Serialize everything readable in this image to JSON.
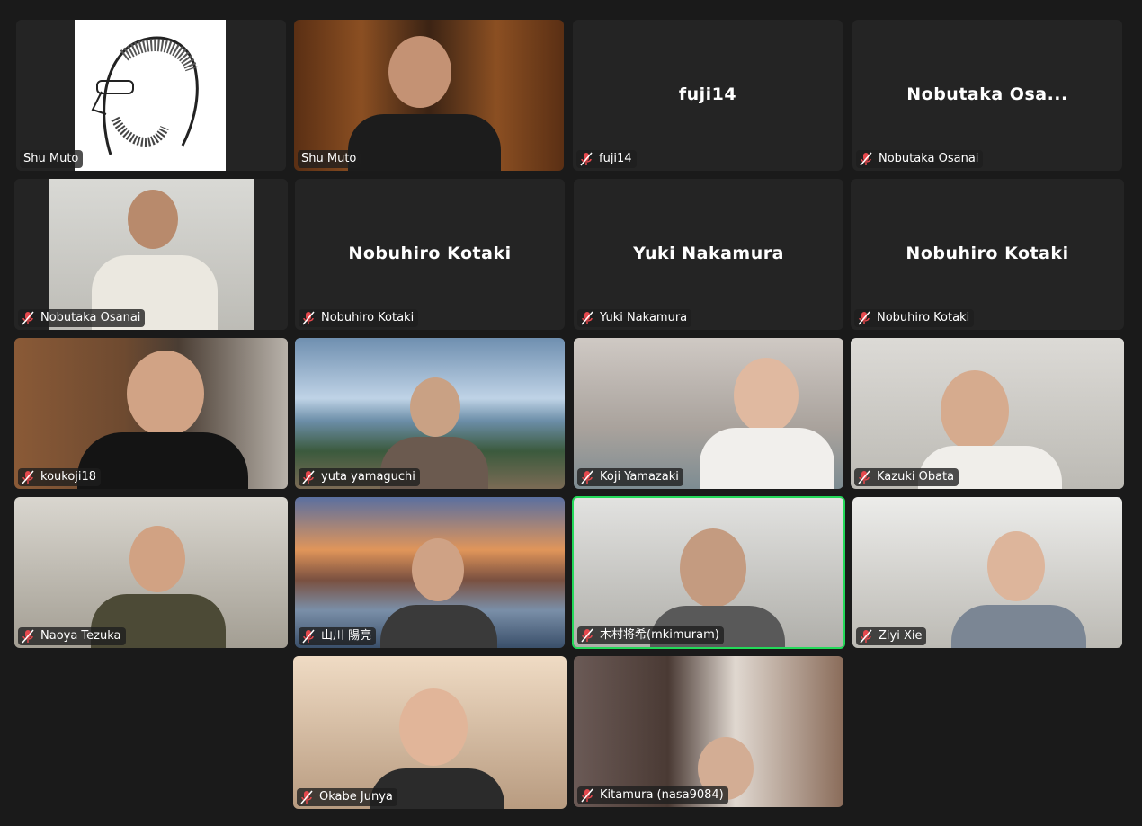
{
  "colors": {
    "background": "#1a1a1a",
    "tile": "#242424",
    "muted_icon": "#e5484d",
    "active_speaker_border": "#23d959"
  },
  "participants": [
    {
      "label": "Shu Muto",
      "muted": false,
      "video": true
    },
    {
      "label": "Shu Muto",
      "muted": false,
      "video": true
    },
    {
      "label": "fuji14",
      "display_name": "fuji14",
      "muted": true,
      "video": false
    },
    {
      "label": "Nobutaka Osanai",
      "display_name": "Nobutaka Osa...",
      "muted": true,
      "video": false
    },
    {
      "label": "Nobutaka Osanai",
      "muted": true,
      "video": true
    },
    {
      "label": "Nobuhiro Kotaki",
      "display_name": "Nobuhiro Kotaki",
      "muted": true,
      "video": false
    },
    {
      "label": "Yuki Nakamura",
      "display_name": "Yuki Nakamura",
      "muted": true,
      "video": false
    },
    {
      "label": "Nobuhiro Kotaki",
      "display_name": "Nobuhiro Kotaki",
      "muted": true,
      "video": false
    },
    {
      "label": "koukoji18",
      "muted": true,
      "video": true
    },
    {
      "label": "yuta yamaguchi",
      "muted": true,
      "video": true
    },
    {
      "label": "Koji Yamazaki",
      "muted": true,
      "video": true
    },
    {
      "label": "Kazuki Obata",
      "muted": true,
      "video": true
    },
    {
      "label": "Naoya Tezuka",
      "muted": true,
      "video": true
    },
    {
      "label": "山川 陽亮",
      "muted": true,
      "video": true
    },
    {
      "label": "木村将希(mkimuram)",
      "muted": true,
      "video": true,
      "speaking": true
    },
    {
      "label": "Ziyi Xie",
      "muted": true,
      "video": true
    },
    {
      "label": "Okabe Junya",
      "muted": true,
      "video": true
    },
    {
      "label": "Kitamura (nasa9084)",
      "muted": true,
      "video": true
    }
  ]
}
